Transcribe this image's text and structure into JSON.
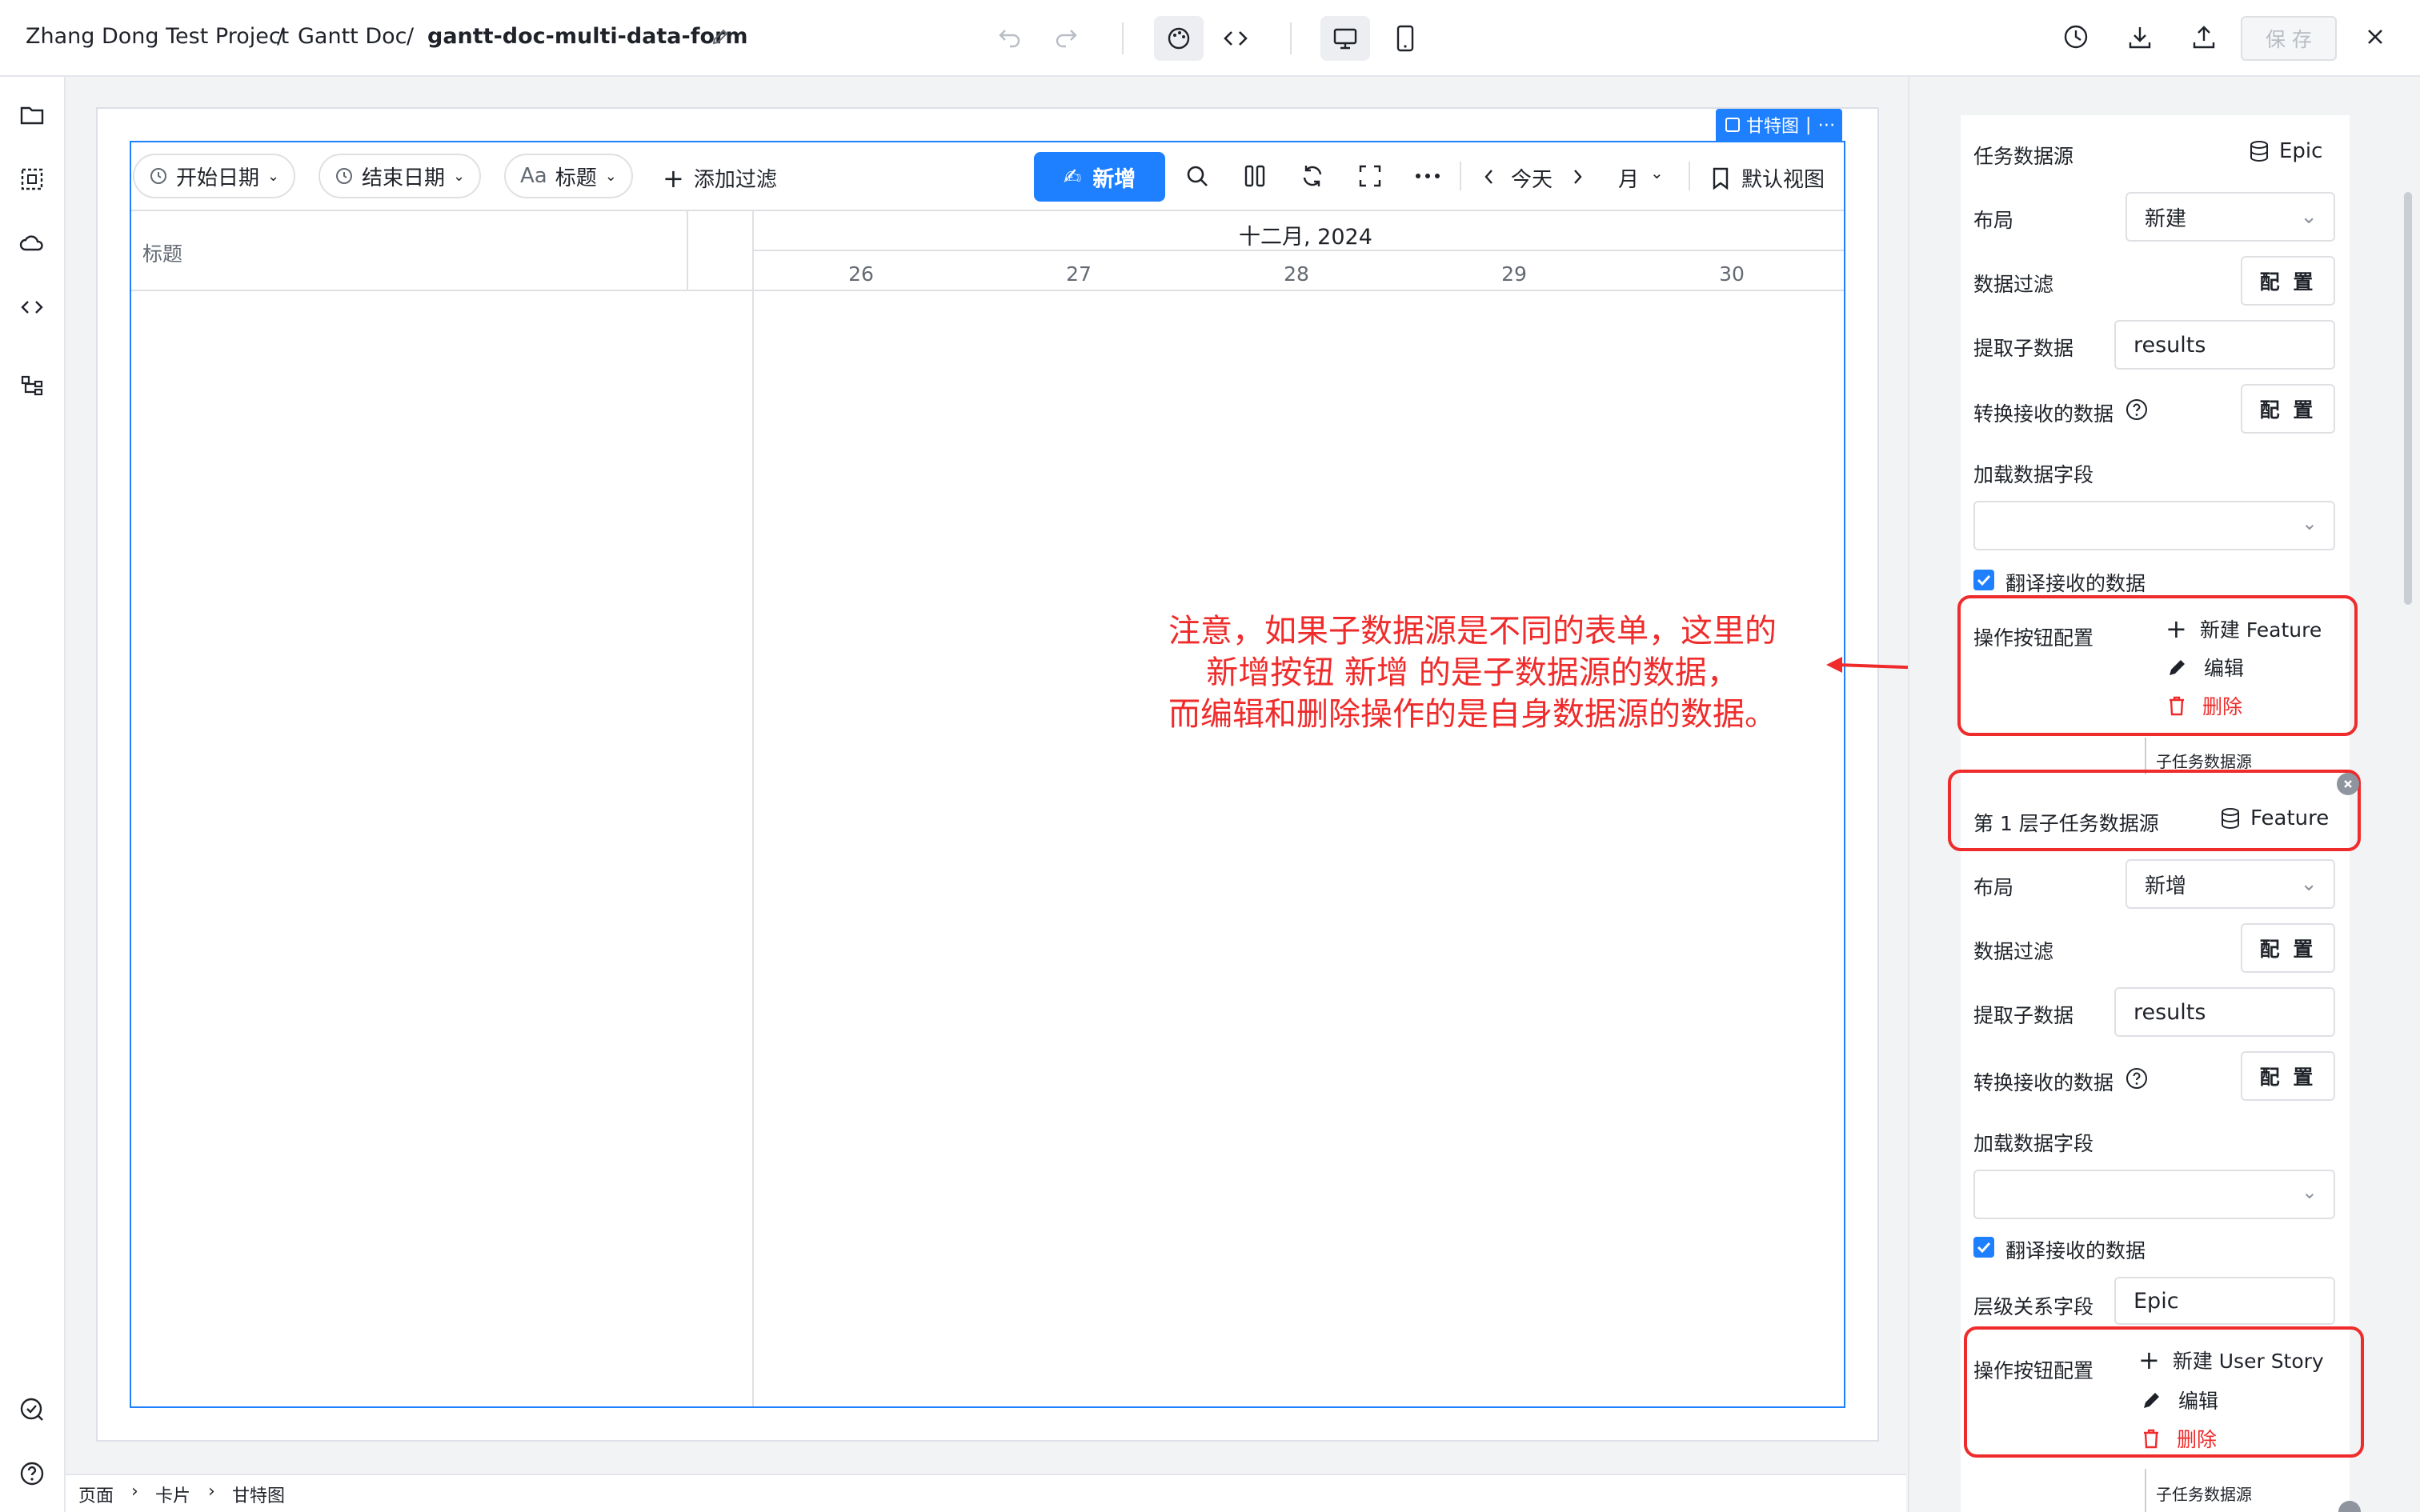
{
  "breadcrumb": {
    "project": "Zhang Dong Test Project",
    "sep": "/",
    "doc": "Gantt Doc",
    "page": "gantt-doc-multi-data-form"
  },
  "header": {
    "save": "保 存"
  },
  "toolbar": {
    "start_date": "开始日期",
    "end_date": "结束日期",
    "title_filter_prefix": "Aa",
    "title_filter": "标题",
    "add_filter": "添加过滤",
    "add": "新增",
    "add_emoji": "✍",
    "today": "今天",
    "month": "月",
    "default_view": "默认视图"
  },
  "gantt": {
    "tag": "甘特图",
    "column_title": "标题",
    "month_label": "十二月, 2024",
    "days": [
      "26",
      "27",
      "28",
      "29",
      "30"
    ]
  },
  "annotation": {
    "lines": [
      "注意，如果子数据源是不同的表单，这里的",
      "新增按钮 新增 的是子数据源的数据，",
      "而编辑和删除操作的是自身数据源的数据。"
    ],
    "color": "#ef2b2b"
  },
  "bottom_breadcrumb": [
    "页面",
    "卡片",
    "甘特图"
  ],
  "panel": {
    "level0": {
      "datasource_label": "任务数据源",
      "datasource_value": "Epic",
      "layout_label": "布局",
      "layout_value": "新建",
      "filter_label": "数据过滤",
      "filter_btn": "配 置",
      "extract_label": "提取子数据",
      "extract_value": "results",
      "transform_label": "转换接收的数据",
      "transform_btn": "配 置",
      "load_fields_label": "加载数据字段",
      "translate_label": "翻译接收的数据",
      "actions_label": "操作按钮配置",
      "actions": {
        "create": "新建 Feature",
        "edit": "编辑",
        "delete": "删除"
      }
    },
    "child_label": "子任务数据源",
    "level1": {
      "datasource_label": "第 1 层子任务数据源",
      "datasource_value": "Feature",
      "layout_label": "布局",
      "layout_value": "新增",
      "filter_label": "数据过滤",
      "filter_btn": "配 置",
      "extract_label": "提取子数据",
      "extract_value": "results",
      "transform_label": "转换接收的数据",
      "transform_btn": "配 置",
      "load_fields_label": "加载数据字段",
      "translate_label": "翻译接收的数据",
      "hierarchy_label": "层级关系字段",
      "hierarchy_value": "Epic",
      "actions_label": "操作按钮配置",
      "actions": {
        "create": "新建 User Story",
        "edit": "编辑",
        "delete": "删除"
      }
    },
    "child_label_2": "子任务数据源"
  },
  "colors": {
    "accent": "#1e80ff",
    "danger": "#ef2b2b"
  }
}
